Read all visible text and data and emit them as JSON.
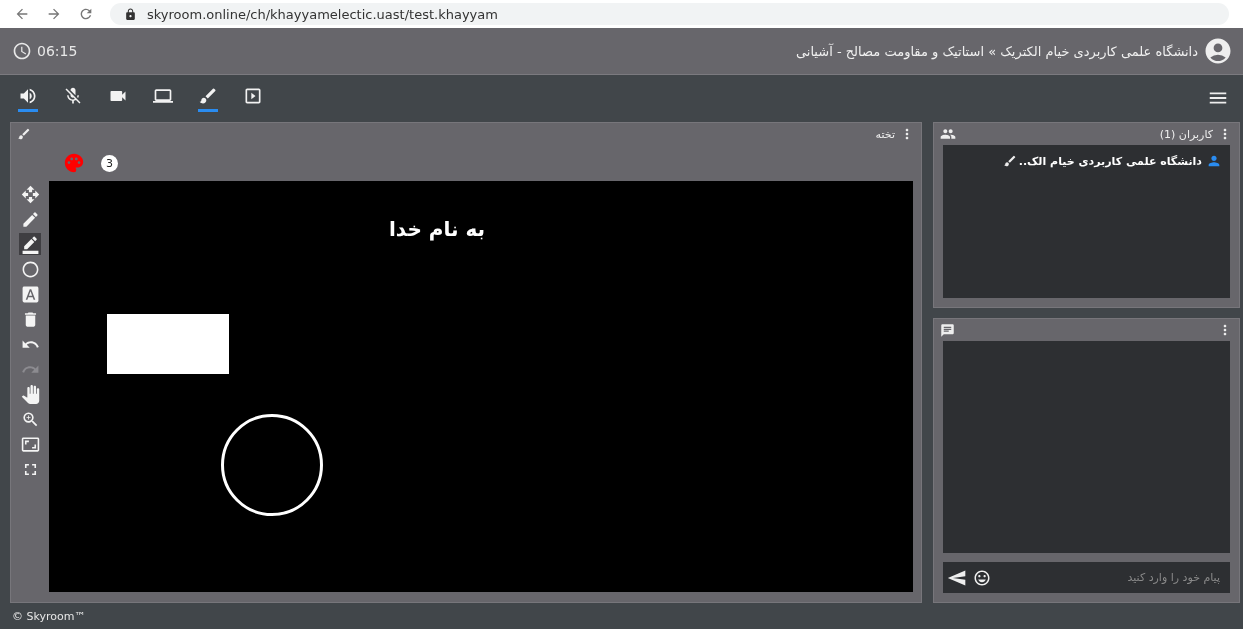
{
  "browser": {
    "url": "skyroom.online/ch/khayyamelectic.uast/test.khayyam"
  },
  "header": {
    "time": "06:15",
    "title": "دانشگاه علمی کاربردی خیام الکتریک » استاتیک و مقاومت مصالح - آشیانی"
  },
  "toolbar": [
    {
      "kind": "speaker",
      "selected": true
    },
    {
      "kind": "mic-off",
      "selected": false
    },
    {
      "kind": "camera",
      "selected": false
    },
    {
      "kind": "screen",
      "selected": false
    },
    {
      "kind": "brush",
      "selected": true
    },
    {
      "kind": "present",
      "selected": false
    }
  ],
  "whiteboard": {
    "title": "تخته",
    "size": "3",
    "tools": [
      {
        "kind": "move",
        "selected": false,
        "disabled": false
      },
      {
        "kind": "pencil",
        "selected": false,
        "disabled": false
      },
      {
        "kind": "line",
        "selected": true,
        "disabled": false
      },
      {
        "kind": "circle",
        "selected": false,
        "disabled": false
      },
      {
        "kind": "text",
        "selected": false,
        "disabled": false
      },
      {
        "kind": "delete",
        "selected": false,
        "disabled": false
      },
      {
        "kind": "undo",
        "selected": false,
        "disabled": false
      },
      {
        "kind": "redo",
        "selected": false,
        "disabled": true
      },
      {
        "kind": "pan",
        "selected": false,
        "disabled": false
      },
      {
        "kind": "zoom",
        "selected": false,
        "disabled": false
      },
      {
        "kind": "fit",
        "selected": false,
        "disabled": false
      },
      {
        "kind": "fullscreen",
        "selected": false,
        "disabled": false
      }
    ],
    "board_text": "به نام خدا"
  },
  "users": {
    "title": "کاربران (1)",
    "items": [
      {
        "name": "دانشگاه علمی کاربردی خیام الک.."
      }
    ]
  },
  "chat": {
    "placeholder": "پیام خود را وارد کنید"
  },
  "footer": "© Skyroom™"
}
